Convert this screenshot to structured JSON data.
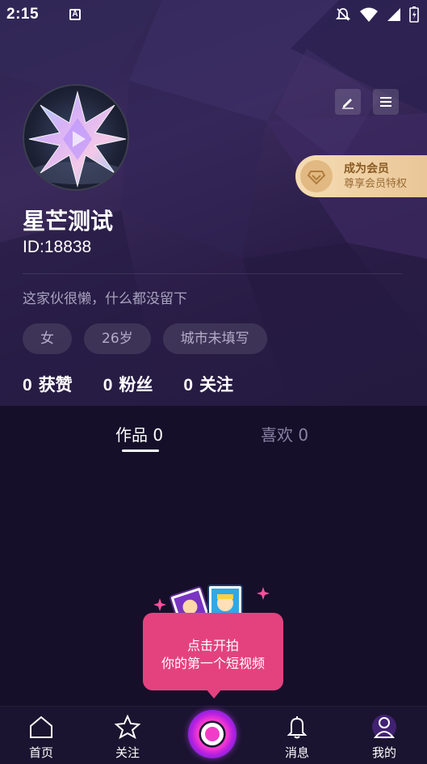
{
  "status_bar": {
    "time": "2:15",
    "notif_badge": "A"
  },
  "profile": {
    "nickname": "星芒测试",
    "id_text": "ID:18838",
    "bio": "这家伙很懒，什么都没留下",
    "tags": [
      "女",
      "26岁",
      "城市未填写"
    ],
    "stats": [
      {
        "num": "0",
        "label": "获赞"
      },
      {
        "num": "0",
        "label": "粉丝"
      },
      {
        "num": "0",
        "label": "关注"
      }
    ]
  },
  "vip": {
    "title": "成为会员",
    "subtitle": "尊享会员特权"
  },
  "tabs": [
    {
      "label": "作品 0",
      "active": true
    },
    {
      "label": "喜欢 0",
      "active": false
    }
  ],
  "empty_state": {
    "line1": "点击开拍",
    "line2": "你的第一个短视频"
  },
  "bottom_nav": [
    {
      "label": "首页",
      "icon": "home-icon"
    },
    {
      "label": "关注",
      "icon": "star-icon"
    },
    {
      "label": "",
      "icon": "record-icon"
    },
    {
      "label": "消息",
      "icon": "bell-icon"
    },
    {
      "label": "我的",
      "icon": "person-icon"
    }
  ],
  "colors": {
    "accent_pink": "#e4427f",
    "vip_gold": "#f5dcb4",
    "background": "#150f2a"
  }
}
